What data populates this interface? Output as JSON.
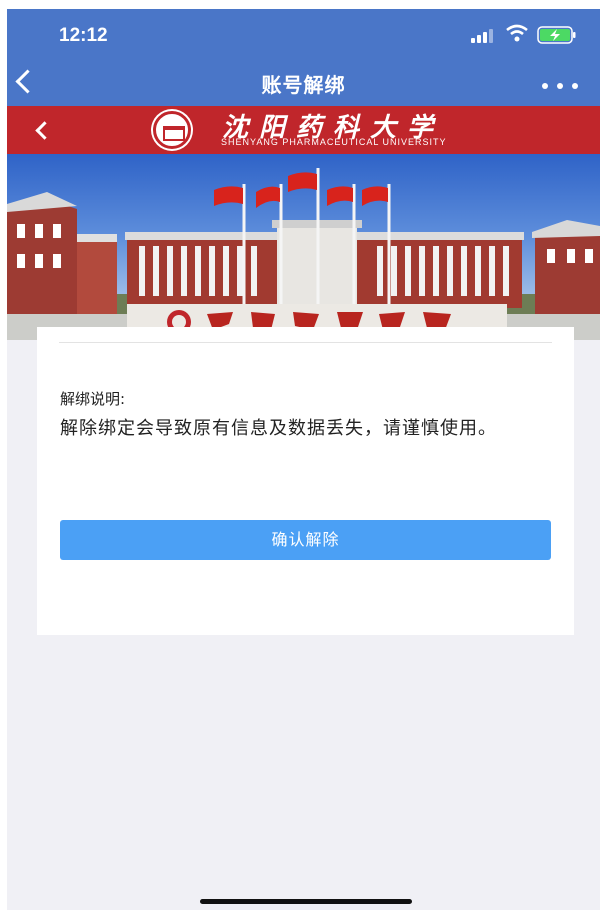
{
  "status_bar": {
    "time": "12:12"
  },
  "nav": {
    "title": "账号解绑"
  },
  "university": {
    "name_cn": "沈阳药科大学",
    "name_en": "SHENYANG PHARMACEUTICAL UNIVERSITY",
    "accent_color": "#c0262b"
  },
  "card": {
    "label": "解绑说明:",
    "description": "解除绑定会导致原有信息及数据丢失，请谨慎使用。",
    "confirm_label": "确认解除",
    "confirm_color": "#4ba0f5"
  },
  "colors": {
    "nav_bar": "#4a76c8",
    "page_bg": "#f0f0f5"
  }
}
